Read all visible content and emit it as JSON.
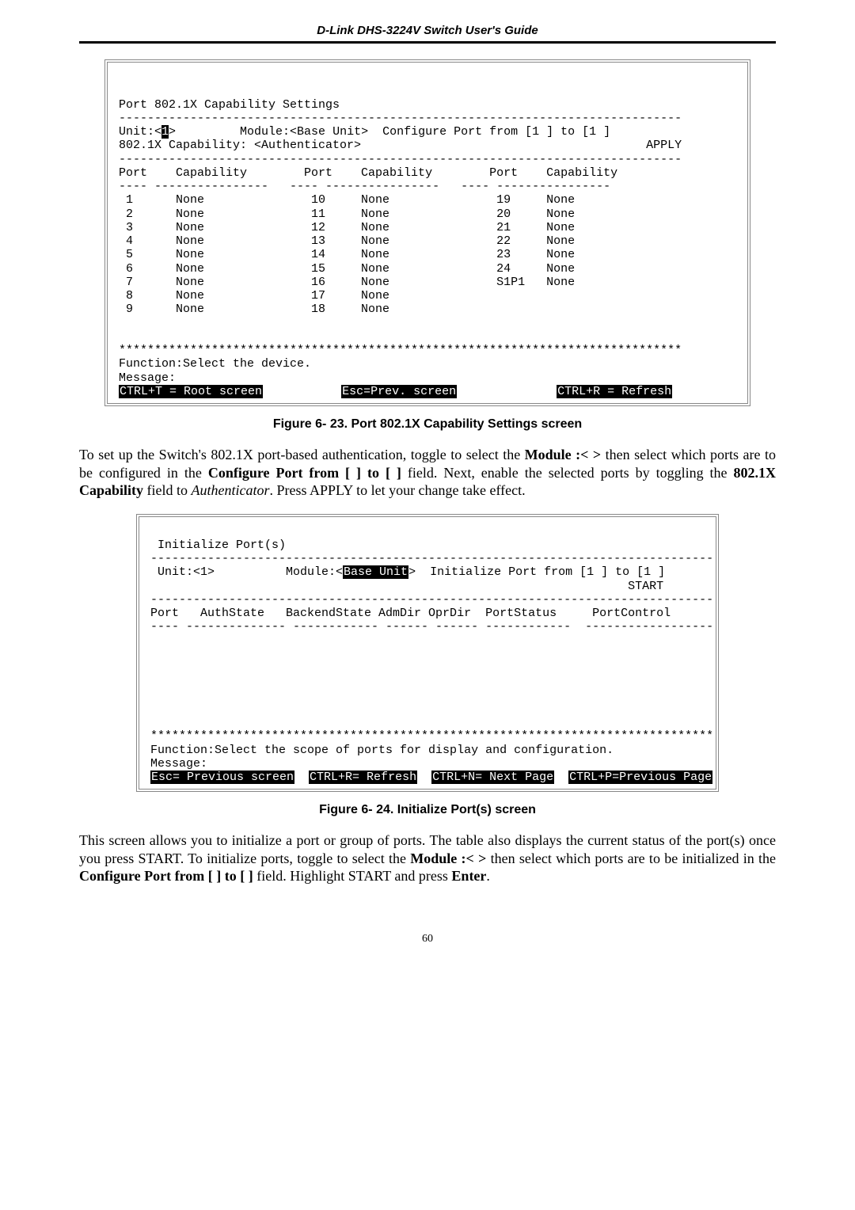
{
  "header": {
    "title": "D-Link DHS-3224V Switch User's Guide"
  },
  "term1": {
    "title": "Port 802.1X Capability Settings",
    "rule": "-------------------------------------------------------------------------------",
    "line_unit": "Unit:<",
    "line_unit_cursor": "1",
    "line_unit_after": ">         Module:<Base Unit>  Configure Port from [1 ] to [1 ]",
    "capability_line": "802.1X Capability: <Authenticator>                                        APPLY",
    "hdr": "Port    Capability        Port    Capability        Port    Capability",
    "hdr_dash": "---- ----------------   ---- ----------------   ---- ----------------",
    "rows": [
      " 1      None               10     None               19     None",
      " 2      None               11     None               20     None",
      " 3      None               12     None               21     None",
      " 4      None               13     None               22     None",
      " 5      None               14     None               23     None",
      " 6      None               15     None               24     None",
      " 7      None               16     None               S1P1   None",
      " 8      None               17     None",
      " 9      None               18     None"
    ],
    "stars": "*******************************************************************************",
    "func": "Function:Select the device.",
    "msg": "Message:",
    "foot_left": "CTRL+T = Root screen",
    "foot_mid": "Esc=Prev. screen",
    "foot_right": "CTRL+R = Refresh"
  },
  "caption1": "Figure 6- 23.  Port 802.1X Capability Settings screen",
  "para1_a": "To set up the Switch's 802.1X port-based authentication, toggle to select the ",
  "para1_b": "Module :<  >",
  "para1_c": " then select which ports are to be configured in the ",
  "para1_d": "Configure Port from [  ] to [  ]",
  "para1_e": " field. Next, enable the selected ports by toggling the ",
  "para1_f": "802.1X Capability",
  "para1_g": " field to ",
  "para1_h": "Authenticator",
  "para1_i": ". Press APPLY to let your change take effect.",
  "term2": {
    "title": " Initialize Port(s)",
    "rule": "-------------------------------------------------------------------------------",
    "line_unit": " Unit:<1>          Module:<",
    "line_unit_inv": "Base Unit",
    "line_unit_after": ">  Initialize Port from [1 ] to [1 ]",
    "start_line": "                                                                   START",
    "dash2": "-------------------------------------------------------------------------------",
    "hdr": "Port   AuthState   BackendState AdmDir OprDir  PortStatus     PortControl",
    "hdr_dash": "---- -------------- ------------ ------ ------ ------------  ------------------",
    "stars": "*******************************************************************************",
    "func": "Function:Select the scope of ports for display and configuration.",
    "msg": "Message:",
    "foot_a": "Esc= Previous screen",
    "foot_b": "CTRL+R= Refresh",
    "foot_c": "CTRL+N= Next Page",
    "foot_d": "CTRL+P=Previous Page"
  },
  "caption2": "Figure 6- 24.  Initialize Port(s) screen",
  "para2_a": "This screen allows you to initialize a port or group of ports. The table also displays the current status of the port(s) once you press START.  To initialize ports, toggle to select the ",
  "para2_b": "Module :<  >",
  "para2_c": " then select which ports are to be initialized in the ",
  "para2_d": "Configure Port from [  ] to [  ]",
  "para2_e": " field. Highlight START and press ",
  "para2_f": "Enter",
  "para2_g": ".",
  "pagenum": "60"
}
